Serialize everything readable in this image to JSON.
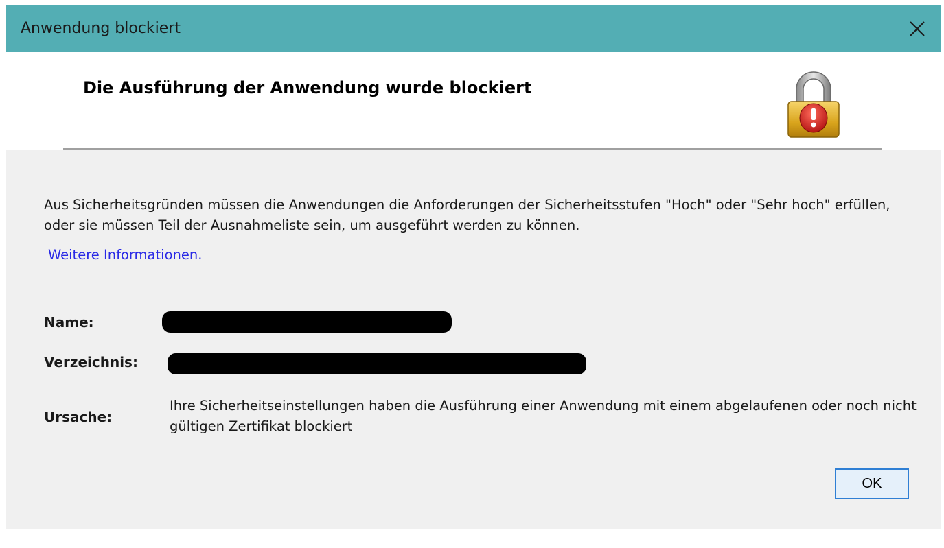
{
  "window": {
    "title": "Anwendung blockiert",
    "titlebar_color": "#53aeb4",
    "close_icon": "close-icon"
  },
  "header": {
    "headline": "Die Ausführung der Anwendung wurde blockiert",
    "icon": "padlock-warning-icon"
  },
  "body": {
    "description": "Aus Sicherheitsgründen müssen die Anwendungen die Anforderungen der Sicherheitsstufen \"Hoch\" oder \"Sehr hoch\" erfüllen, oder sie müssen Teil der Ausnahmeliste sein, um ausgeführt werden zu können.",
    "more_info_link": "Weitere Informationen.",
    "link_color": "#2a2ae6",
    "fields": {
      "name_label": "Name:",
      "directory_label": "Verzeichnis:",
      "cause_label": "Ursache:",
      "cause_text": "Ihre Sicherheitseinstellungen haben die Ausführung einer Anwendung mit einem abgelaufenen oder noch nicht gültigen Zertifikat blockiert"
    }
  },
  "buttons": {
    "ok_label": "OK"
  }
}
